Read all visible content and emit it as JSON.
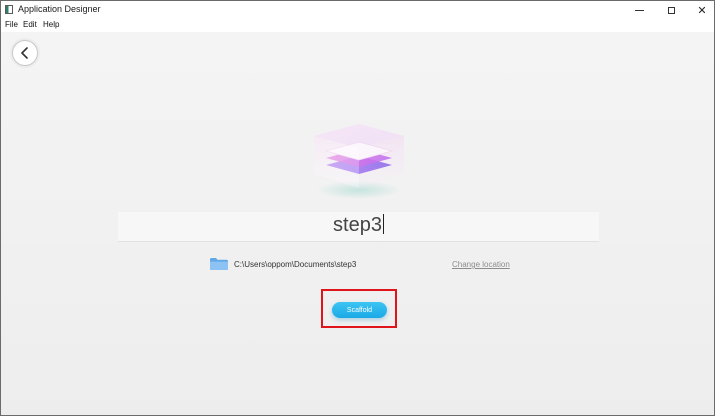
{
  "window": {
    "title": "Application Designer",
    "controls": {
      "minimize_icon": "minimize-icon",
      "maximize_icon": "maximize-icon",
      "close_glyph": "✕"
    }
  },
  "menu": {
    "items": [
      {
        "label": "File"
      },
      {
        "label": "Edit"
      },
      {
        "label": "Help"
      }
    ]
  },
  "main": {
    "back_icon": "chevron-left-icon",
    "logo_icon": "stacked-layers-logo",
    "project_name": "step3",
    "folder_icon": "folder-icon",
    "project_path": "C:\\Users\\oppom\\Documents\\step3",
    "change_location_label": "Change location",
    "scaffold_label": "Scaffold"
  },
  "colors": {
    "accent": "#1fb1ea",
    "highlight": "#e0141b",
    "background": "#f1f1f1"
  }
}
